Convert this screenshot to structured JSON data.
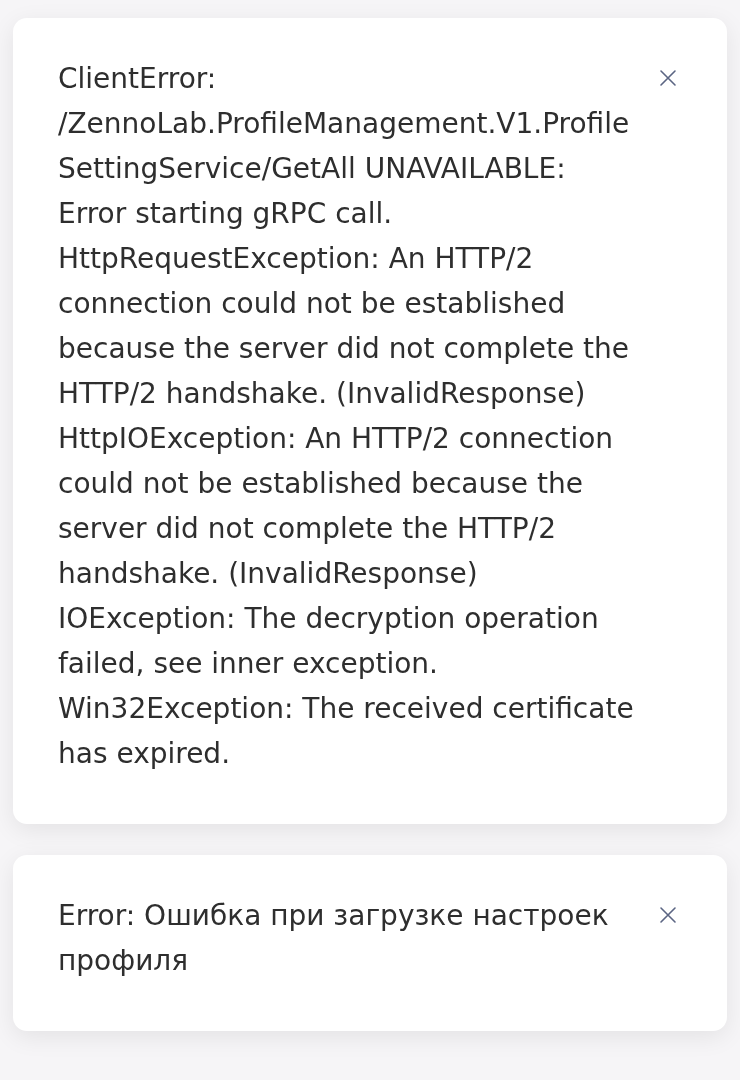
{
  "toasts": [
    {
      "kind": "error",
      "message": "ClientError: /ZennoLab.ProfileManagement.V1.ProfileSettingService/GetAll UNAVAILABLE: Error starting gRPC call. HttpRequestException: An HTTP/2 connection could not be established because the server did not complete the HTTP/2 handshake. (InvalidResponse) HttpIOException: An HTTP/2 connection could not be established because the server did not complete the HTTP/2 handshake. (InvalidResponse) IOException: The decryption operation failed, see inner exception. Win32Exception: The received certificate has expired."
    },
    {
      "kind": "error",
      "message": "Error: Ошибка при загрузке настроек профиля"
    }
  ]
}
